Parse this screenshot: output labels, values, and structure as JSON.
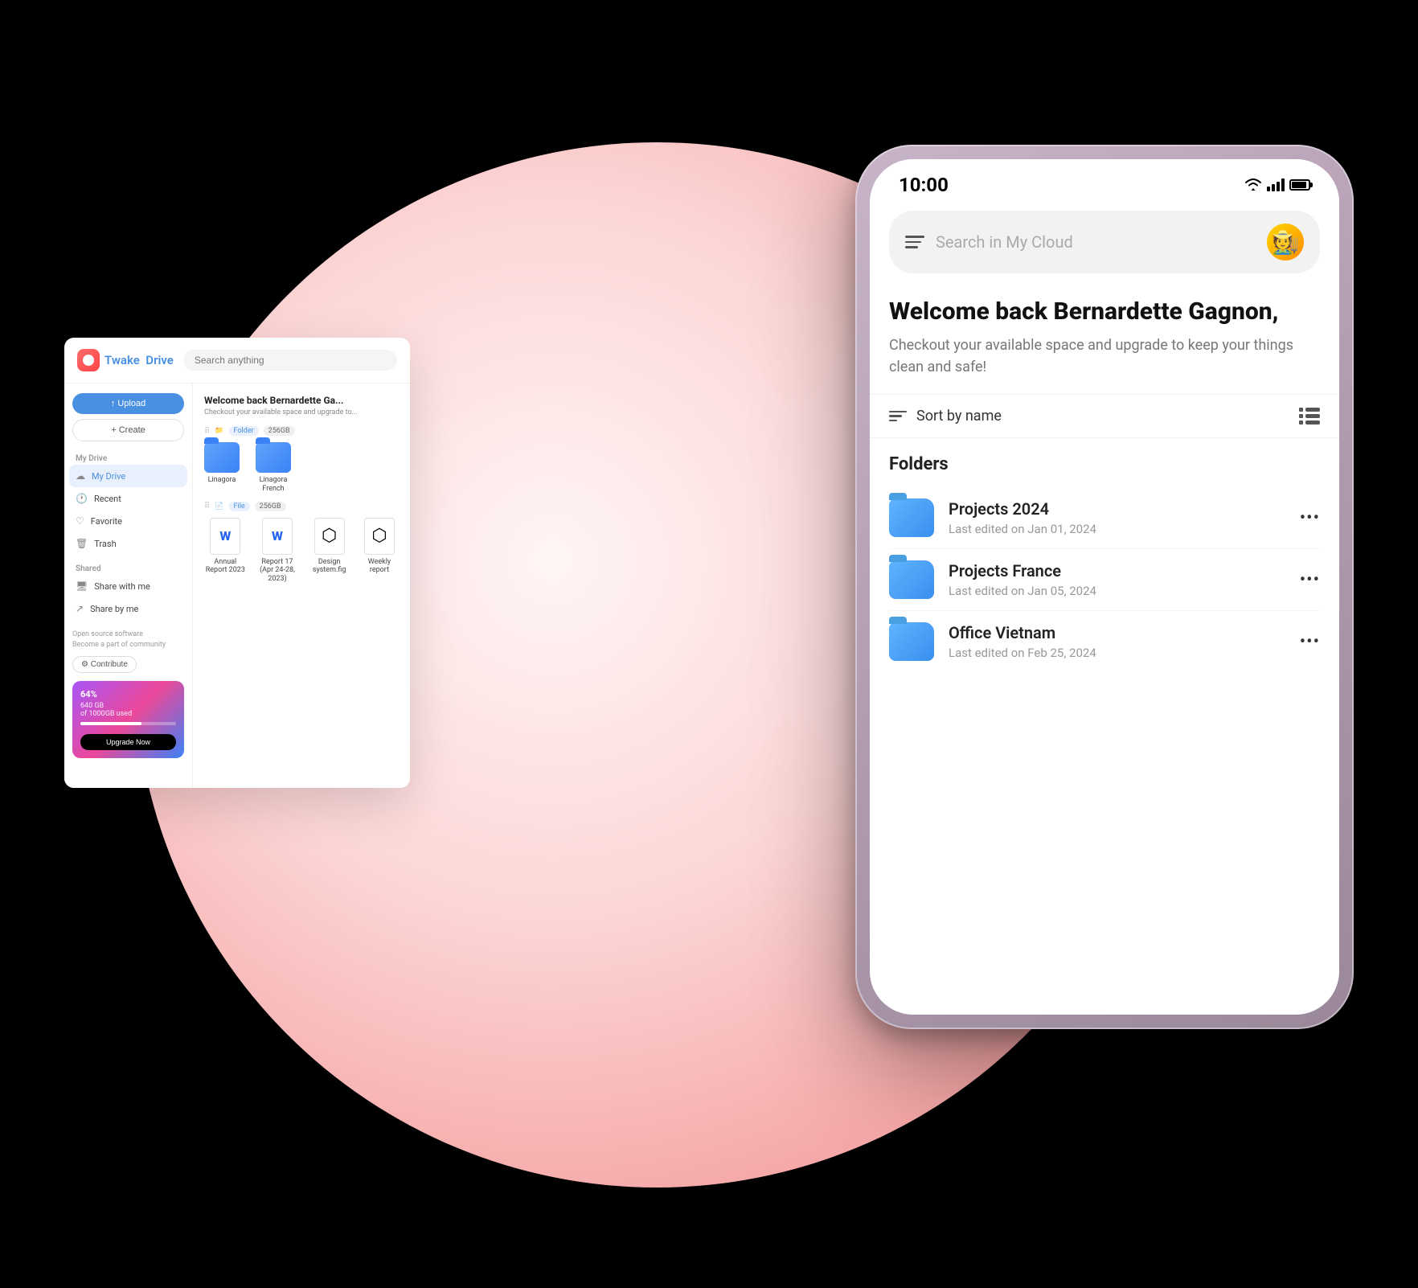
{
  "scene": {
    "background": "#000"
  },
  "desktop": {
    "logo": {
      "brand": "Twake",
      "product": "Drive"
    },
    "search_placeholder": "Search anything",
    "upload_btn": "↑ Upload",
    "create_btn": "+ Create",
    "sidebar": {
      "my_drive_section": "My Drive",
      "items": [
        {
          "label": "My Drive",
          "active": true
        },
        {
          "label": "Recent",
          "active": false
        },
        {
          "label": "Favorite",
          "active": false
        },
        {
          "label": "Trash",
          "active": false
        }
      ],
      "shared_section": "Shared",
      "shared_items": [
        {
          "label": "Share with me"
        },
        {
          "label": "Share by me"
        }
      ],
      "footer": {
        "title": "Open source software",
        "subtitle": "Become a part of community",
        "contribute_btn": "⚙ Contribute"
      },
      "storage": {
        "percent": "64%",
        "used": "640 GB",
        "total": "of 1000GB used",
        "upgrade_btn": "Upgrade Now"
      }
    },
    "welcome": {
      "title": "Welcome back Bernardette Ga...",
      "subtitle": "Checkout your available space and upgrade to..."
    },
    "file_sections": [
      {
        "type": "Folder",
        "size": "256GB",
        "files": [
          {
            "name": "Linagora",
            "type": "folder"
          },
          {
            "name": "Linagora French",
            "type": "folder"
          }
        ]
      },
      {
        "type": "File",
        "size": "256GB",
        "files": [
          {
            "name": "Annual Report 2023",
            "type": "word"
          },
          {
            "name": "Report 17 (Apr 24-28, 2023)",
            "type": "word"
          },
          {
            "name": "Design system.fig",
            "type": "figma"
          },
          {
            "name": "Weekly report",
            "type": "figma"
          }
        ]
      }
    ]
  },
  "phone": {
    "status_bar": {
      "time": "10:00"
    },
    "search": {
      "placeholder": "Search in My Cloud"
    },
    "welcome": {
      "title": "Welcome back Bernardette Gagnon,",
      "subtitle": "Checkout your available space and upgrade to keep your things clean and safe!"
    },
    "sort": {
      "label": "Sort by name"
    },
    "folders_section": {
      "title": "Folders",
      "items": [
        {
          "name": "Projects 2024",
          "date": "Last edited on Jan 01, 2024"
        },
        {
          "name": "Projects France",
          "date": "Last edited on Jan 05, 2024"
        },
        {
          "name": "Office Vietnam",
          "date": "Last edited on Feb 25, 2024"
        }
      ]
    }
  }
}
